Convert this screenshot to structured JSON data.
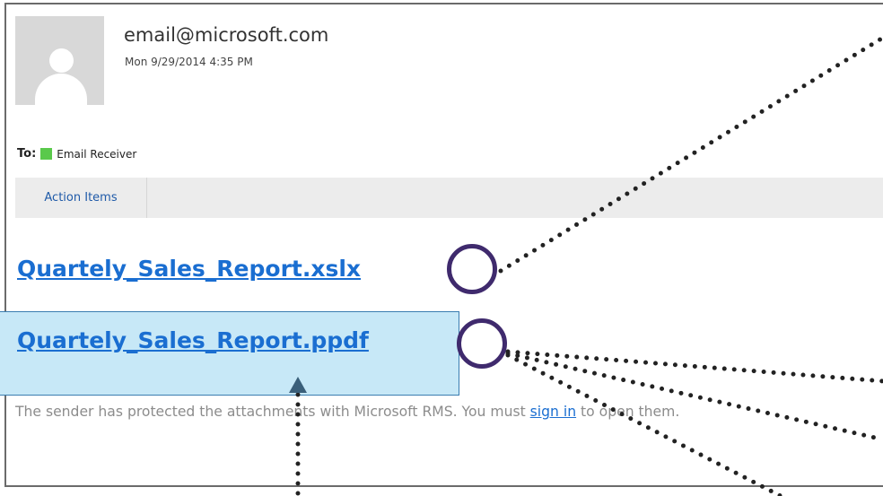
{
  "header": {
    "sender": "email@microsoft.com",
    "timestamp": "Mon 9/29/2014 4:35 PM"
  },
  "recipients": {
    "to_label": "To:",
    "to_name": "Email Receiver",
    "presence_color": "#5ac94b"
  },
  "tabs": [
    {
      "label": "Action Items"
    }
  ],
  "attachments": [
    {
      "name": "Quartely_Sales_Report.xslx"
    },
    {
      "name": "Quartely_Sales_Report.ppdf"
    }
  ],
  "notice": {
    "before": "The sender has protected the attachments with Microsoft RMS. You must ",
    "link": "sign in",
    "after": " to open them."
  },
  "colors": {
    "link": "#1a6ed1",
    "highlight": "#c7e8f7",
    "annotation_circle": "#3f2a6d",
    "annotation_dots": "#222222"
  }
}
